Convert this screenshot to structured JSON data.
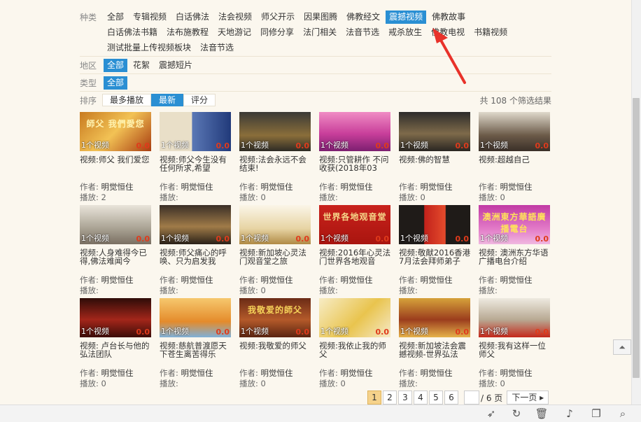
{
  "filters": {
    "category": {
      "label": "种类",
      "options": [
        "全部",
        "专辑视频",
        "白话佛法",
        "法会视频",
        "师父开示",
        "因果图腾",
        "佛教经文",
        "震撼视频",
        "佛教故事",
        "白话佛法书籍",
        "法布施教程",
        "天地游记",
        "同修分享",
        "法门相关",
        "法音节选",
        "戒杀放生",
        "佛教电视",
        "书籍视频",
        "测试批量上传视频板块",
        "法音节选"
      ],
      "active_index": 7
    },
    "region": {
      "label": "地区",
      "options": [
        "全部",
        "花絮",
        "震撼短片"
      ],
      "active_index": 0
    },
    "type": {
      "label": "类型",
      "options": [
        "全部"
      ],
      "active_index": 0
    }
  },
  "sort": {
    "label": "排序",
    "options": [
      "最多播放",
      "最新",
      "评分"
    ],
    "active_index": 1,
    "result_count": "共 108 个筛选结果"
  },
  "videos": [
    {
      "title": "视频:师父 我们爱您",
      "author": "明觉恒住",
      "plays": "2",
      "tag": "1个视频",
      "rating": "0.0",
      "caption": "師父 我們愛您",
      "bg": "linear-gradient(135deg,#c87a20,#f2c255 50%,#a83c10)",
      "capcolor": "#fff3b0"
    },
    {
      "title": "视频:师父今生没有任何所求,希望",
      "author": "明觉恒住",
      "plays": "",
      "tag": "1个视频",
      "rating": "0.0",
      "caption": "",
      "bg": "linear-gradient(90deg,#e9dfc8 45%,#5a77b5 46%,#213a7a)",
      "capcolor": "#000"
    },
    {
      "title": "视频:法会永远不会结束!",
      "author": "明觉恒住",
      "plays": "0",
      "tag": "1个视频",
      "rating": "0.0",
      "caption": "",
      "bg": "linear-gradient(180deg,#3b3a36,#8a6e3a 60%,#2d2a25)",
      "capcolor": "#fff"
    },
    {
      "title": "视频:只管耕作 不问收获(2018年03",
      "author": "明觉恒住",
      "plays": "",
      "tag": "1个视频",
      "rating": "0.0",
      "caption": "",
      "bg": "linear-gradient(180deg,#f08cc4,#c93f9b 55%,#7c1f70)",
      "capcolor": "#fff"
    },
    {
      "title": "视频:佛的智慧",
      "author": "明觉恒住",
      "plays": "0",
      "tag": "1个视频",
      "rating": "0.0",
      "caption": "",
      "bg": "linear-gradient(180deg,#2d2c2a,#7e6a4a 55%,#2a2622)",
      "capcolor": "#fff"
    },
    {
      "title": "视频:超越自己",
      "author": "明觉恒住",
      "plays": "0",
      "tag": "1个视频",
      "rating": "0.0",
      "caption": "",
      "bg": "linear-gradient(180deg,#dfd9cc,#6b5a48 60%,#3a2f28)",
      "capcolor": "#fff"
    },
    {
      "title": "视频:人身难得今已得,佛法难闻今",
      "author": "明觉恒住",
      "plays": "",
      "tag": "1个视频",
      "rating": "0.0",
      "caption": "",
      "bg": "linear-gradient(180deg,#e9e4da,#a9a293 60%,#7a6f62)",
      "capcolor": "#fff"
    },
    {
      "title": "视频:师父痛心的呼唤、只为启发我",
      "author": "明觉恒住",
      "plays": "",
      "tag": "1个视频",
      "rating": "0.0",
      "caption": "",
      "bg": "linear-gradient(180deg,#3a2f27,#a07b48 55%,#2a2118)",
      "capcolor": "#fff"
    },
    {
      "title": "视频:新加坡心灵法门观音堂之旅",
      "author": "明觉恒住",
      "plays": "0",
      "tag": "1个视频",
      "rating": "0.0",
      "caption": "",
      "bg": "linear-gradient(180deg,#fbf6e8,#e7d4a4 60%,#b08a45)",
      "capcolor": "#b0261c"
    },
    {
      "title": "视频:2016年心灵法门世界各地观音",
      "author": "明觉恒住",
      "plays": "",
      "tag": "1个视频",
      "rating": "0.0",
      "caption": "世界各地观音堂",
      "bg": "linear-gradient(180deg,#c9221c,#a9150f)",
      "capcolor": "#f6d88a"
    },
    {
      "title": "视频:敬献2016香港7月法会拜师弟子",
      "author": "明觉恒住",
      "plays": "",
      "tag": "1个视频",
      "rating": "0.0",
      "caption": "",
      "bg": "linear-gradient(90deg,#1f1b18 35%,#c2221b 36%,#e44b2c 65%,#1f1b18 66%)",
      "capcolor": "#fff"
    },
    {
      "title": "视频: 澳洲东方华语广播电台介绍",
      "author": "明觉恒住",
      "plays": "",
      "tag": "1个视频",
      "rating": "0.0",
      "caption": "澳洲東方華語廣播電台",
      "bg": "linear-gradient(180deg,#c13aa4,#e27ac7 60%,#f0b8e0)",
      "capcolor": "#ffe35a"
    },
    {
      "title": "视频: 卢台长与他的弘法团队",
      "author": "明觉恒住",
      "plays": "0",
      "tag": "1个视频",
      "rating": "0.0",
      "caption": "",
      "bg": "linear-gradient(180deg,#2e0c08,#a3261a 55%,#3c0d08)",
      "capcolor": "#fff"
    },
    {
      "title": "视频:慈航普渡愿天下苍生离苦得乐",
      "author": "明觉恒住",
      "plays": "",
      "tag": "1个视频",
      "rating": "0.0",
      "caption": "",
      "bg": "linear-gradient(180deg,#f6c86e,#e48b2b 60%,#7fb0d8)",
      "capcolor": "#fff"
    },
    {
      "title": "视频:我敬爱的师父",
      "author": "明觉恒住",
      "plays": "0",
      "tag": "1个视频",
      "rating": "0.0",
      "caption": "我敬爱的師父",
      "bg": "linear-gradient(180deg,#6b2b16,#b45a2a 55%,#5a2410)",
      "capcolor": "#f6d35a"
    },
    {
      "title": "视频:我依止我的师父",
      "author": "明觉恒住",
      "plays": "0",
      "tag": "1个视频",
      "rating": "0.0",
      "caption": "",
      "bg": "linear-gradient(135deg,#f7ecc5,#e9c44e 55%,#f5e9c8)",
      "capcolor": "#7a4a10"
    },
    {
      "title": "视频:新加坡法会震撼视频-世界弘法",
      "author": "明觉恒住",
      "plays": "",
      "tag": "1个视频",
      "rating": "0.0",
      "caption": "",
      "bg": "linear-gradient(180deg,#d6a23a,#9b3d1d 55%,#e6b24a)",
      "capcolor": "#fff"
    },
    {
      "title": "视频:我有这样一位师父",
      "author": "明觉恒住",
      "plays": "0",
      "tag": "1个视频",
      "rating": "0.0",
      "caption": "",
      "bg": "linear-gradient(180deg,#eeeae0,#b8a993 55%,#c4281b)",
      "capcolor": "#fff"
    }
  ],
  "meta_labels": {
    "author": "作者:",
    "plays": "播放:"
  },
  "pager": {
    "pages": [
      "1",
      "2",
      "3",
      "4",
      "5",
      "6"
    ],
    "active_index": 0,
    "total": "/ 6 页",
    "next": "下一页 ▸"
  },
  "backtop": "⏶"
}
